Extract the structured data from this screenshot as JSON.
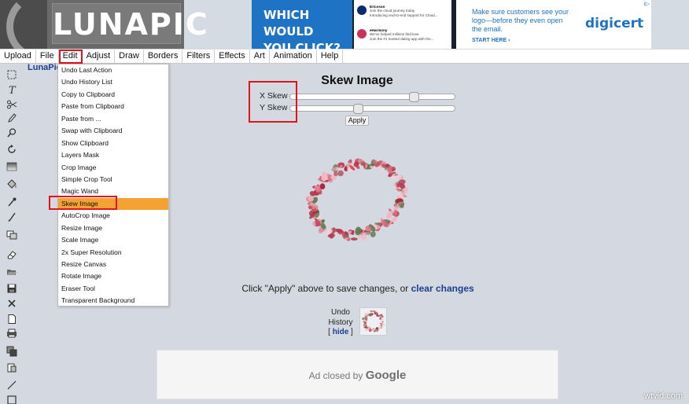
{
  "logo": {
    "text": "LUNAPIC"
  },
  "ads": {
    "left": {
      "headline": "WHICH WOULD YOU CLICK?"
    },
    "notifications": [
      {
        "title": "Ericsson",
        "line1": "Join the cloud journey today",
        "line2": "Introducing end-to-end support for Cloud..."
      },
      {
        "title": "eHarmony",
        "line1": "We've helped millions find love",
        "line2": "Join the #1 trusted dating app with the..."
      }
    ],
    "right": {
      "text": "Make sure customers see your logo—before they even open the email.",
      "cta": "START HERE ›",
      "brand": "digicert",
      "corner": "i▷"
    }
  },
  "menubar": [
    "Upload",
    "File",
    "Edit",
    "Adjust",
    "Draw",
    "Borders",
    "Filters",
    "Effects",
    "Art",
    "Animation",
    "Help"
  ],
  "brand_link": "LunaPic",
  "edit_menu": {
    "items": [
      "Undo Last Action",
      "Undo History List",
      "Copy to Clipboard",
      "Paste from Clipboard",
      "Paste from ...",
      "Swap with Clipboard",
      "Show Clipboard",
      "Layers Mask",
      "Crop Image",
      "Simple Crop Tool",
      "Magic Wand",
      "Skew Image",
      "AutoCrop Image",
      "Resize Image",
      "Scale Image",
      "2x Super Resolution",
      "Resize Canvas",
      "Rotate Image",
      "Eraser Tool",
      "Transparent Background"
    ],
    "selected": "Skew Image"
  },
  "tool": {
    "title": "Skew Image",
    "x_skew": {
      "label": "X Skew",
      "value": 0.77
    },
    "y_skew": {
      "label": "Y Skew",
      "value": 0.41
    },
    "apply_label": "Apply"
  },
  "apply_note": {
    "prefix": "Click \"Apply\" above to save changes, or ",
    "link": "clear changes"
  },
  "undo": {
    "line1": "Undo",
    "line2": "History",
    "open": "[ ",
    "link": "hide",
    "close": " ]"
  },
  "ad_closed": {
    "prefix": "Ad closed by ",
    "brand": "Google"
  },
  "watermark": "wtvid.com",
  "colors": {
    "menu_highlight": "#e0151b",
    "selected_item": "#f4a234",
    "link": "#1c3f8f",
    "background": "#d4d9e1"
  },
  "toolbar_icons": [
    "marquee-select-icon",
    "text-icon",
    "scissors-icon",
    "pencil-icon",
    "magnifier-icon",
    "rotate-icon",
    "gradient-icon",
    "paint-bucket-icon",
    "eyedropper-icon",
    "brush-icon",
    "layers-icon",
    "eraser-icon",
    "open-folder-icon",
    "save-icon",
    "close-icon",
    "new-page-icon",
    "print-icon",
    "copy-layers-icon",
    "paste-icon",
    "line-icon",
    "rectangle-icon"
  ]
}
